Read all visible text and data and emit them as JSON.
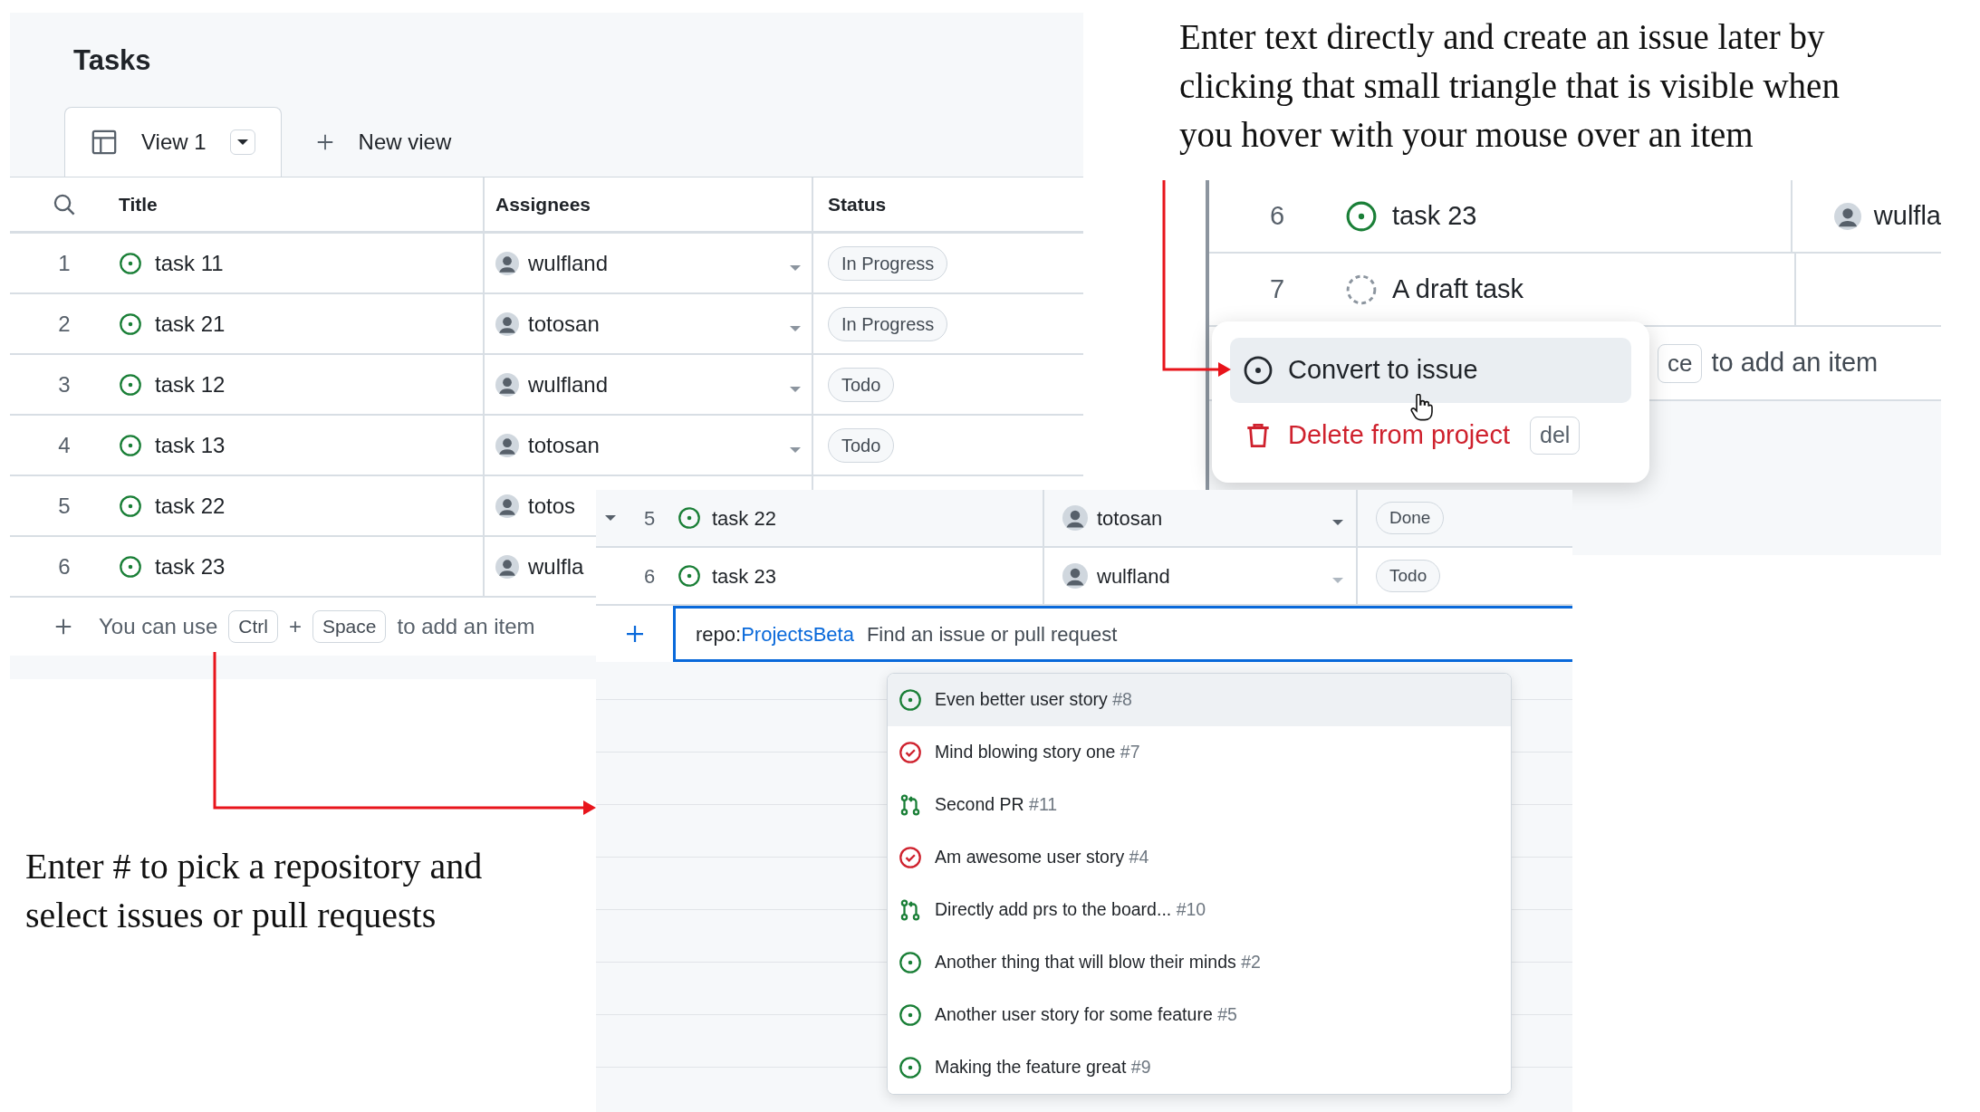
{
  "annotations": [
    {
      "kind": "top",
      "lines": [
        "Enter text directly and create an issue later by",
        "clicking that small triangle that is visible when",
        "you hover with your mouse over an item"
      ]
    },
    {
      "kind": "bottom",
      "lines": [
        "Enter # to pick a repository and",
        "select issues or pull requests"
      ]
    }
  ],
  "tasks_view": {
    "title": "Tasks",
    "tabs": [
      {
        "kind": "view",
        "label": "View 1",
        "selected": true
      },
      {
        "kind": "new",
        "label": "New view",
        "selected": false
      }
    ],
    "columns": [
      "Title",
      "Assignees",
      "Status"
    ],
    "rows": [
      {
        "number": "1",
        "title": "task 11",
        "assignee": "wulfland",
        "status": "In Progress"
      },
      {
        "number": "2",
        "title": "task 21",
        "assignee": "totosan",
        "status": "In Progress"
      },
      {
        "number": "3",
        "title": "task 12",
        "assignee": "wulfland",
        "status": "Todo"
      },
      {
        "number": "4",
        "title": "task 13",
        "assignee": "totosan",
        "status": "Todo"
      },
      {
        "number": "5",
        "title": "task 22",
        "assignee": "totos"
      },
      {
        "number": "6",
        "title": "task 23",
        "assignee": "wulfla"
      }
    ],
    "add_hint": {
      "before": "You can use",
      "keys": [
        "Ctrl",
        "Space"
      ],
      "joiner": "+",
      "after": "to add an item"
    }
  },
  "add_item_view": {
    "rows": [
      {
        "number": "5",
        "title": "task 22",
        "assignee": "totosan",
        "status": "Done",
        "hovered": true
      },
      {
        "number": "6",
        "title": "task 23",
        "assignee": "wulfland",
        "status": "Todo",
        "hovered": false
      }
    ],
    "search": {
      "prefix": "repo:",
      "repo": "ProjectsBeta",
      "placeholder": "Find an issue or pull request"
    },
    "suggestions": [
      {
        "kind": "open_issue",
        "title": "Even better user story",
        "number": "#8",
        "selected": true
      },
      {
        "kind": "closed_issue",
        "title": "Mind blowing story one",
        "number": "#7",
        "selected": false
      },
      {
        "kind": "pull_request",
        "title": "Second PR",
        "number": "#11",
        "selected": false
      },
      {
        "kind": "closed_issue",
        "title": "Am awesome user story",
        "number": "#4",
        "selected": false
      },
      {
        "kind": "pull_request",
        "title": "Directly add prs to the board...",
        "number": "#10",
        "selected": false
      },
      {
        "kind": "open_issue",
        "title": "Another thing that will blow their minds",
        "number": "#2",
        "selected": false
      },
      {
        "kind": "open_issue",
        "title": "Another user story for some feature",
        "number": "#5",
        "selected": false
      },
      {
        "kind": "open_issue",
        "title": "Making the feature great",
        "number": "#9",
        "selected": false
      }
    ]
  },
  "item_menu_view": {
    "rows": [
      {
        "kind": "issue",
        "number": "6",
        "title": "task 23",
        "assignee": "wulfla"
      },
      {
        "kind": "draft",
        "number": "7",
        "title": "A draft task"
      }
    ],
    "add_hint": {
      "key": "ce",
      "after": "to add an item"
    },
    "menu": [
      {
        "kind": "convert",
        "label": "Convert to issue",
        "selected": true
      },
      {
        "kind": "delete",
        "label": "Delete from project",
        "shortcut": "del",
        "selected": false
      }
    ]
  }
}
